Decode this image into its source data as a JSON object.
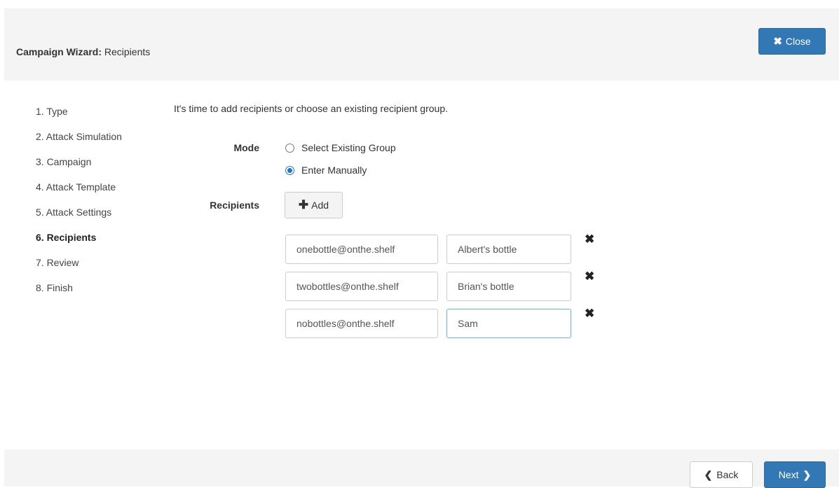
{
  "header": {
    "title_bold": "Campaign Wizard:",
    "title_rest": " Recipients",
    "close_label": "Close",
    "close_icon": "close-icon"
  },
  "steps": [
    {
      "label": "1. Type",
      "active": false
    },
    {
      "label": "2. Attack Simulation",
      "active": false
    },
    {
      "label": "3. Campaign",
      "active": false
    },
    {
      "label": "4. Attack Template",
      "active": false
    },
    {
      "label": "5. Attack Settings",
      "active": false
    },
    {
      "label": "6. Recipients",
      "active": true
    },
    {
      "label": "7. Review",
      "active": false
    },
    {
      "label": "8. Finish",
      "active": false
    }
  ],
  "main": {
    "intro": "It's time to add recipients or choose an existing recipient group.",
    "mode_label": "Mode",
    "mode_options": [
      {
        "label": "Select Existing Group",
        "checked": false
      },
      {
        "label": "Enter Manually",
        "checked": true
      }
    ],
    "recipients_label": "Recipients",
    "add_label": "Add",
    "recipients": [
      {
        "email": "onebottle@onthe.shelf",
        "name": "Albert's bottle"
      },
      {
        "email": "twobottles@onthe.shelf",
        "name": "Brian's bottle"
      },
      {
        "email": "nobottles@onthe.shelf",
        "name": "Sam"
      }
    ]
  },
  "footer": {
    "back_label": "Back",
    "next_label": "Next"
  },
  "colors": {
    "primary": "#3178b5",
    "radio_checked": "#1e73d8",
    "panel_bg": "#f4f4f4"
  }
}
